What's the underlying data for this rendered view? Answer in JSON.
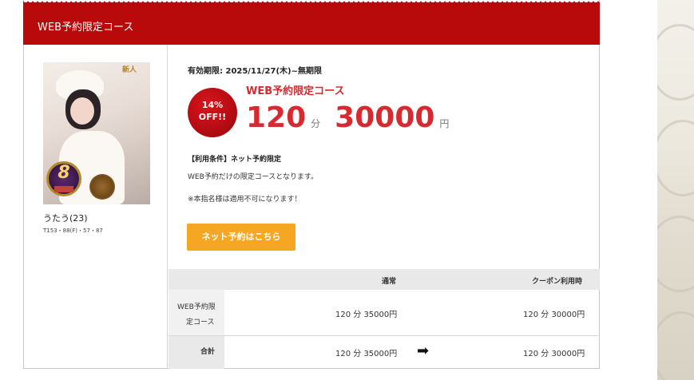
{
  "header": {
    "title": "WEB予約限定コース"
  },
  "therapist": {
    "name": "うたう(23)",
    "specs": "T153・88(F)・57・87",
    "photo_badge_text": "新人"
  },
  "offer": {
    "validity": "有効期限: 2025/11/27(木)~無期限",
    "discount_pct": "14%",
    "discount_off": "OFF!!",
    "course_name": "WEB予約限定コース",
    "minutes": "120",
    "minutes_unit": "分",
    "price": "30000",
    "price_unit": "円",
    "conditions": "【利用条件】ネット予約限定",
    "description": "WEB予約だけの限定コースとなります。",
    "note": "※本指名様は適用不可になります！",
    "cta_label": "ネット予約はこちら"
  },
  "table": {
    "headers": {
      "normal": "通常",
      "coupon": "クーポン利用時"
    },
    "rows": [
      {
        "label_line1": "WEB予約限",
        "label_line2": "定コース",
        "normal": "120 分 35000円",
        "coupon": "120 分 30000円"
      },
      {
        "label": "合計",
        "normal": "120 分 35000円",
        "coupon": "120 分 30000円"
      }
    ]
  },
  "colors": {
    "brand_red": "#b80a0a",
    "price_red": "#d52b30",
    "cta_orange": "#f5a623"
  },
  "icons": {
    "arrow": "right-arrow-icon"
  }
}
